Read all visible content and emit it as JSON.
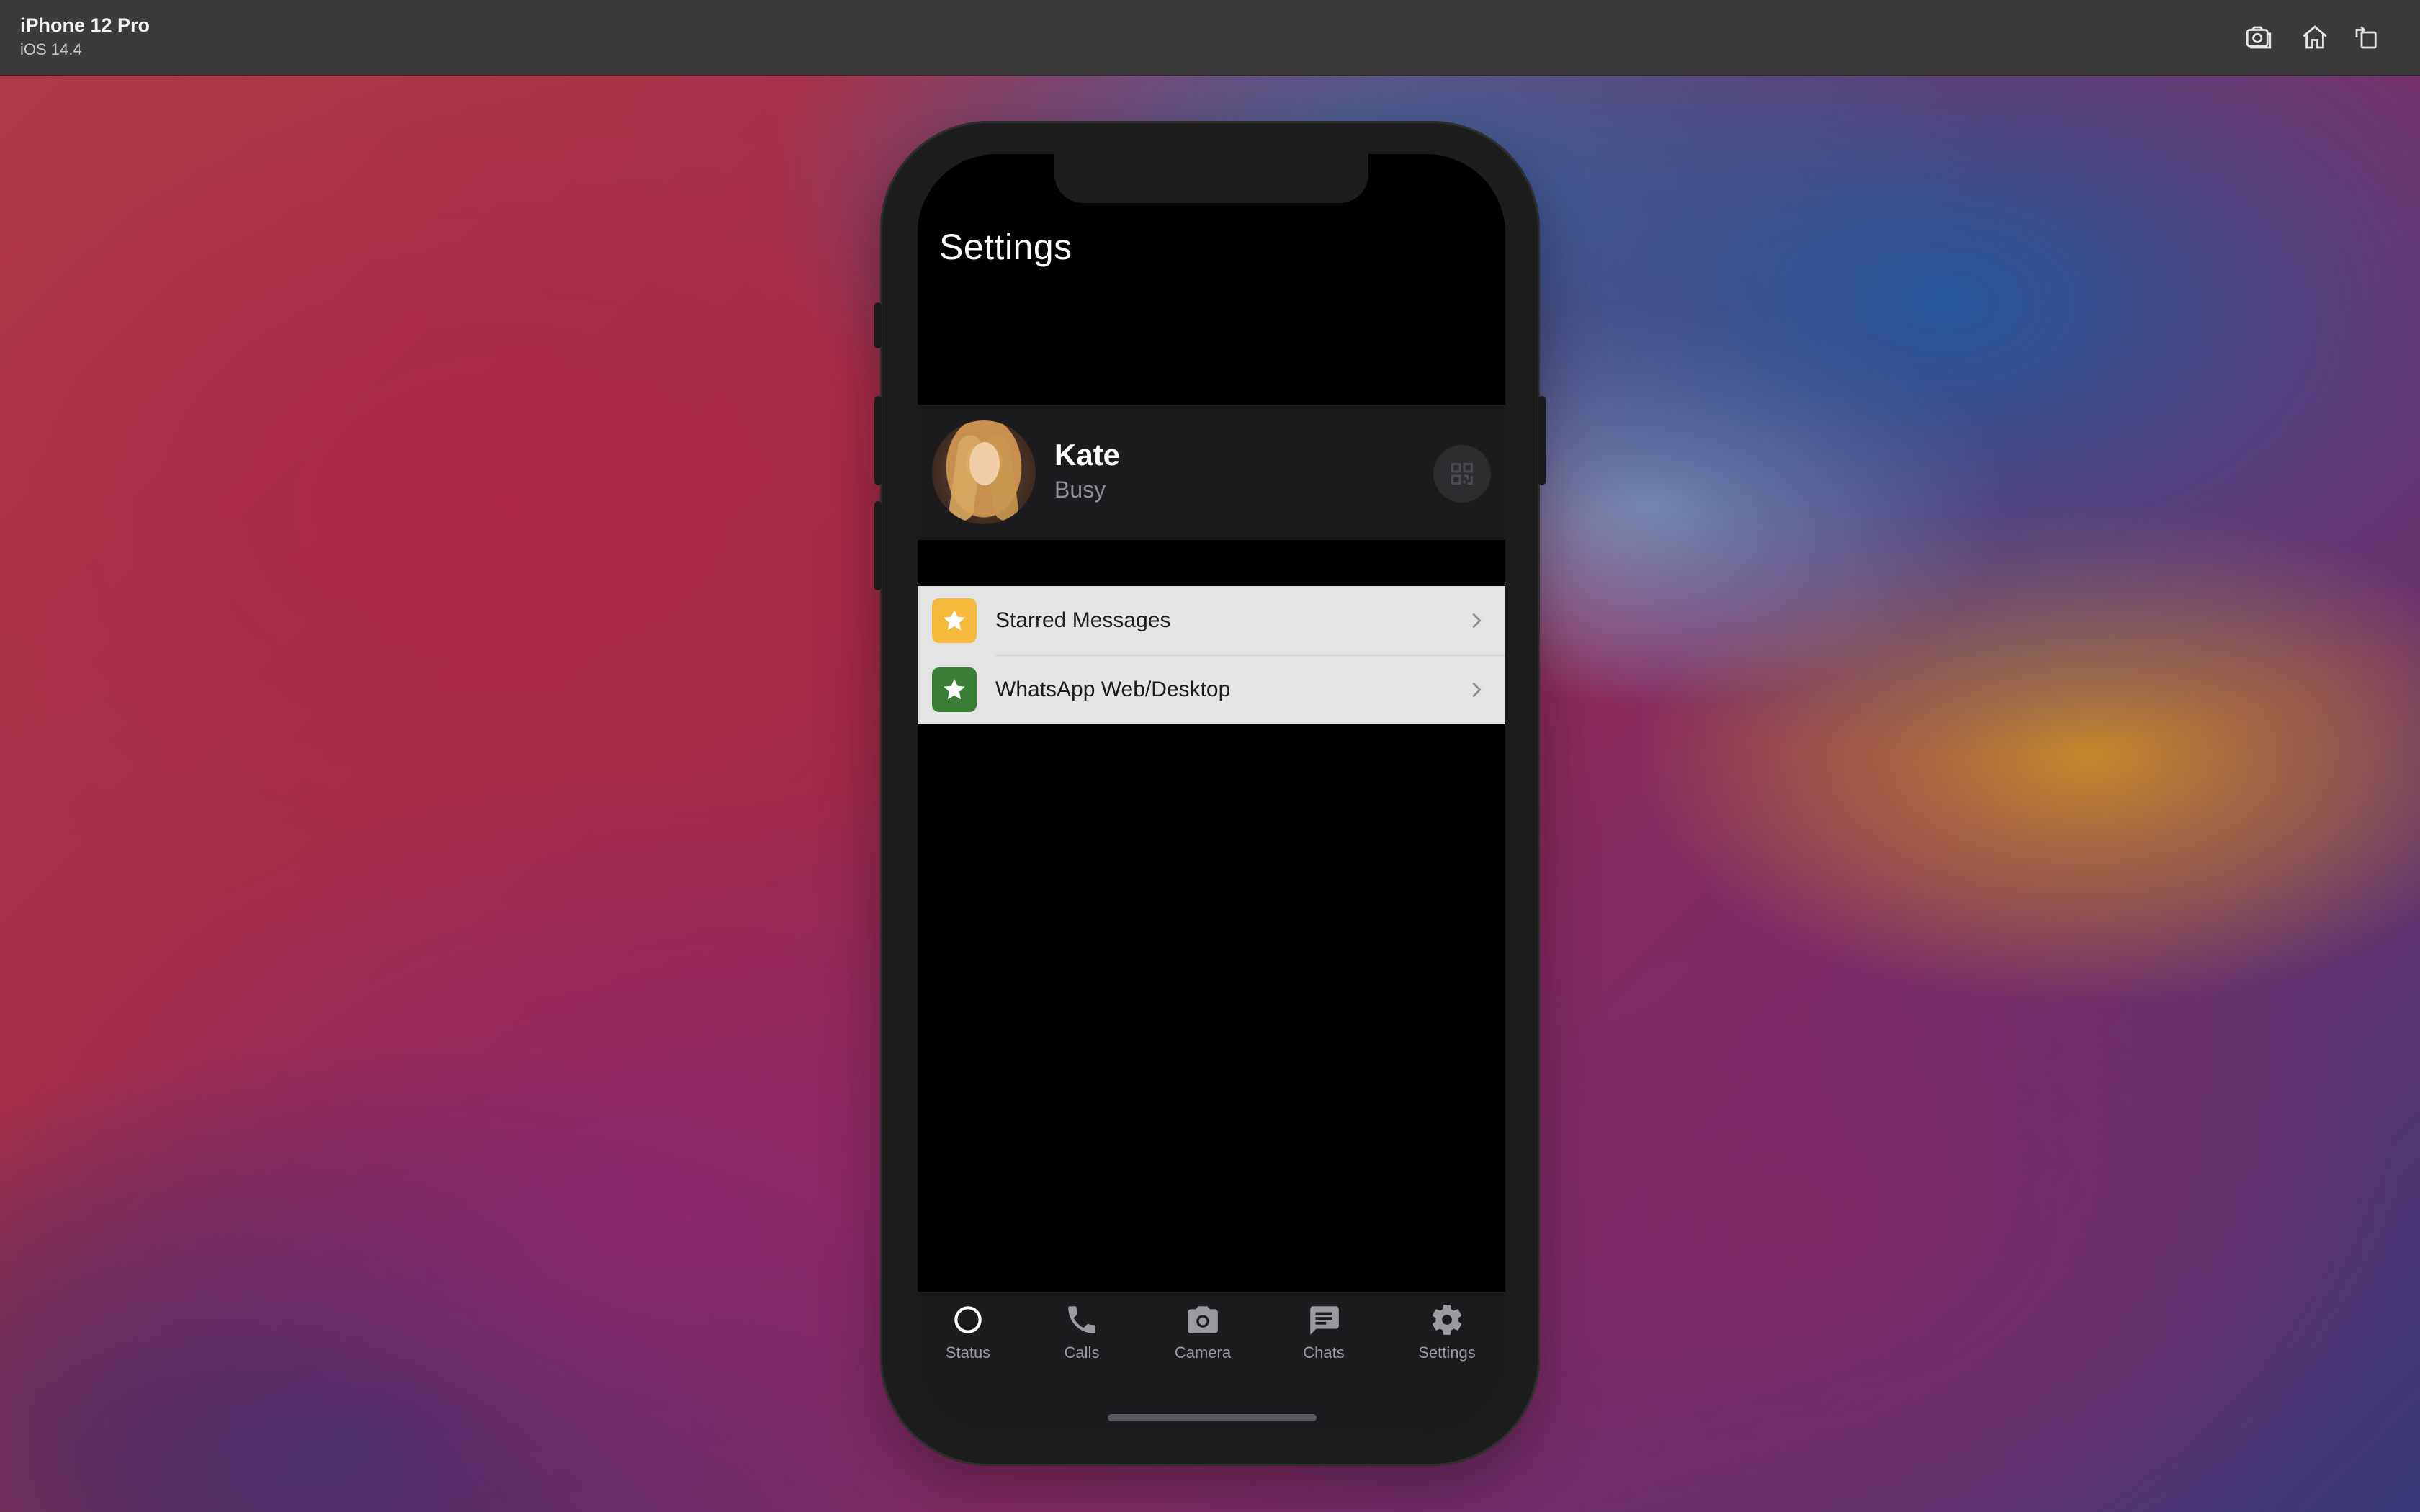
{
  "simulator": {
    "device_name": "iPhone 12 Pro",
    "os_version": "iOS 14.4",
    "toolbar_icons": [
      "screenshot-icon",
      "home-icon",
      "rotate-icon"
    ]
  },
  "app": {
    "page_title": "Settings",
    "profile": {
      "name": "Kate",
      "status": "Busy",
      "qr_icon": "qr-code-icon"
    },
    "menu_items": [
      {
        "label": "Starred Messages",
        "icon": "star-icon",
        "icon_bg": "#f5b93b"
      },
      {
        "label": "WhatsApp Web/Desktop",
        "icon": "star-icon",
        "icon_bg": "#3a7d35"
      }
    ],
    "tabs": [
      {
        "label": "Status",
        "icon": "status-circle-icon"
      },
      {
        "label": "Calls",
        "icon": "phone-icon"
      },
      {
        "label": "Camera",
        "icon": "camera-icon"
      },
      {
        "label": "Chats",
        "icon": "chat-bubble-icon"
      },
      {
        "label": "Settings",
        "icon": "gear-icon"
      }
    ]
  }
}
